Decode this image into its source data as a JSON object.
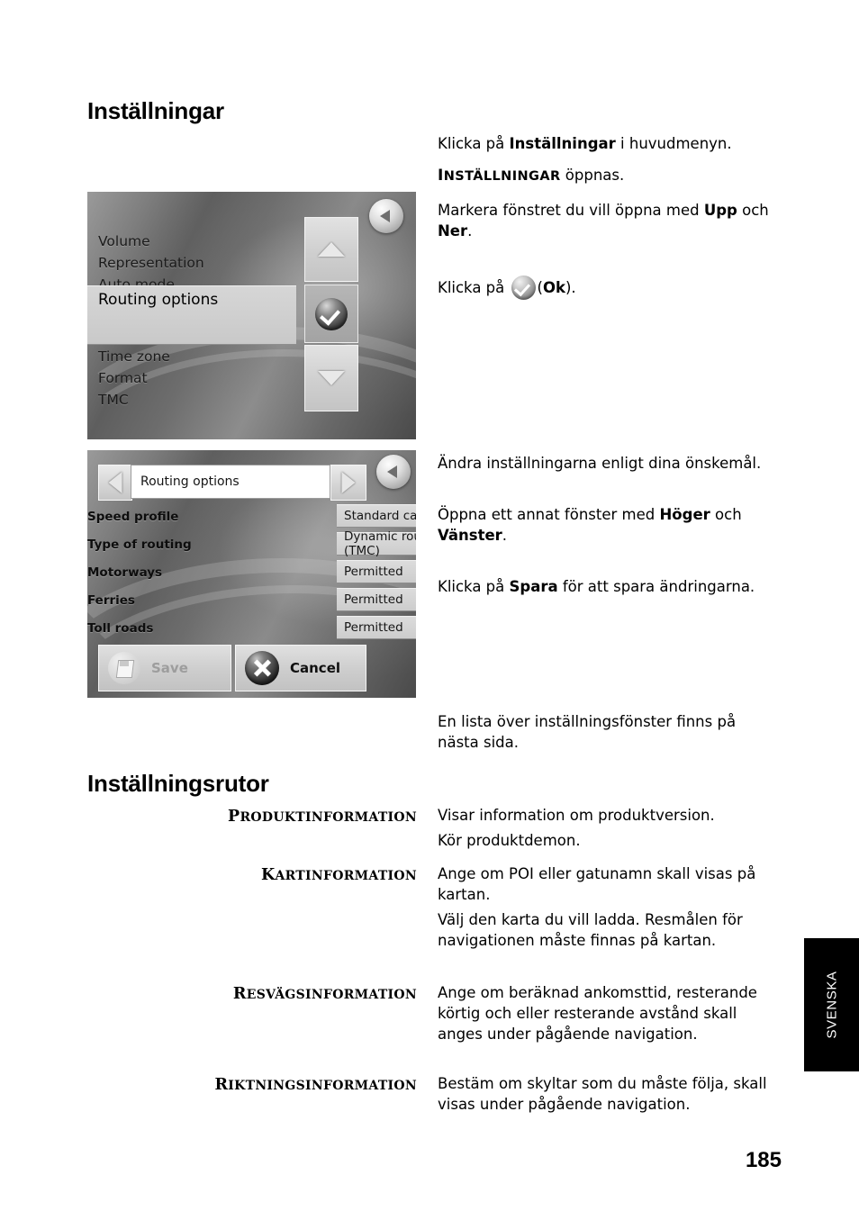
{
  "page": {
    "title": "Inställningar",
    "section_title": "Inställningsrutor",
    "number": "185",
    "language_tab": "SVENSKA"
  },
  "instructions_top": {
    "p1_pre": "Klicka på ",
    "p1_bold": "Inställningar",
    "p1_post": " i huvudmenyn.",
    "p2_caps_first": "I",
    "p2_caps_rest": "NSTÄLLNINGAR",
    "p2_post": " öppnas.",
    "p3_pre": "Markera fönstret du vill öppna med ",
    "p3_bold1": "Upp",
    "p3_mid": " och ",
    "p3_bold2": "Ner",
    "p3_post": ".",
    "p4_pre": "Klicka på ",
    "p4_icon": "ok-check-icon",
    "p4_open": "(",
    "p4_bold": "Ok",
    "p4_close": ")."
  },
  "instructions_middle": {
    "p1": "Ändra inställningarna enligt dina önskemål.",
    "p2_pre": "Öppna ett annat fönster med ",
    "p2_bold1": "Höger",
    "p2_mid": " och ",
    "p2_bold2": "Vänster",
    "p2_post": ".",
    "p3_pre": "Klicka på ",
    "p3_bold": "Spara",
    "p3_post": " för att spara ändringarna."
  },
  "instructions_bottom": {
    "p1": "En lista över inställningsfönster finns på nästa sida."
  },
  "device_settings_list": {
    "back_button": "back-arrow-button",
    "items": [
      "Volume",
      "Representation",
      "Auto mode"
    ],
    "selected_item": "Routing options",
    "items_after": [
      "Time zone",
      "Format",
      "TMC"
    ],
    "pad": {
      "up": "up-arrow-button",
      "ok": "ok-check-button",
      "down": "down-arrow-button"
    }
  },
  "device_routing_options": {
    "back_button": "back-arrow-button",
    "prev_button": "previous-window-button",
    "next_button": "next-window-button",
    "window_title": "Routing options",
    "rows": [
      {
        "label": "Speed profile",
        "value": "Standard car"
      },
      {
        "label": "Type of routing",
        "value": "Dynamic route (TMC)"
      },
      {
        "label": "Motorways",
        "value": "Permitted"
      },
      {
        "label": "Ferries",
        "value": "Permitted"
      },
      {
        "label": "Toll roads",
        "value": "Permitted"
      }
    ],
    "save_label": "Save",
    "cancel_label": "Cancel"
  },
  "settings_windows": [
    {
      "term_first": "P",
      "term_rest": "RODUKTINFORMATION",
      "paragraphs": [
        "Visar information om produktversion.",
        "Kör produktdemon."
      ]
    },
    {
      "term_first": "K",
      "term_rest": "ARTINFORMATION",
      "paragraphs": [
        "Ange om POI eller gatunamn skall visas på kartan.",
        "Välj den karta du vill ladda. Resmålen för navigationen måste finnas på kartan."
      ]
    },
    {
      "term_first": "R",
      "term_rest": "ESVÄGSINFORMATION",
      "paragraphs": [
        "Ange om beräknad ankomsttid, resterande körtig och eller resterande avstånd skall anges under pågående navigation."
      ]
    },
    {
      "term_first": "R",
      "term_rest": "IKTNINGSINFORMATION",
      "paragraphs": [
        "Bestäm om skyltar som du måste följa, skall visas under pågående navigation."
      ]
    }
  ],
  "colors": {
    "page_background": "#ffffff",
    "text": "#000000",
    "language_tab_background": "#000000",
    "language_tab_text": "#ffffff"
  }
}
